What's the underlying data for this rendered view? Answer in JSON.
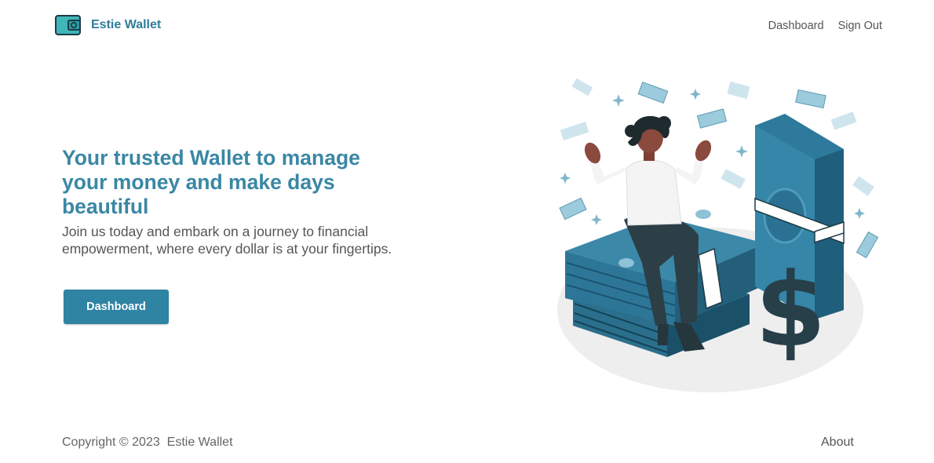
{
  "header": {
    "brand_name": "Estie Wallet",
    "nav": [
      {
        "label": "Dashboard"
      },
      {
        "label": "Sign Out"
      }
    ]
  },
  "hero": {
    "title": "Your trusted Wallet to manage your money and make days beautiful",
    "subtitle": "Join us today and embark on a journey to financial empowerment, where every dollar is at your fingertips.",
    "cta_label": "Dashboard"
  },
  "illustration": {
    "icon": "woman-sitting-on-money-illustration"
  },
  "footer": {
    "copyright": "Copyright © 2023  Estie Wallet",
    "about": "About"
  },
  "colors": {
    "brand": "#2f7d9a",
    "heading": "#3a87a4",
    "button": "#2f83a3",
    "text": "#555555"
  }
}
